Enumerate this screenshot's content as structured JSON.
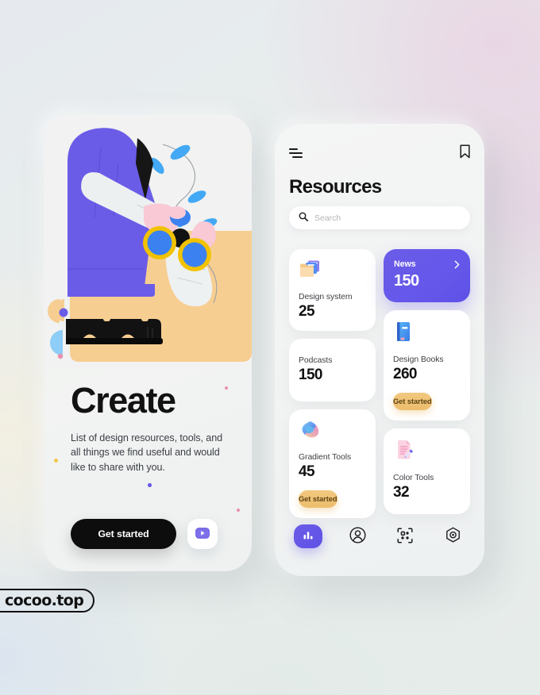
{
  "background": {
    "base_color": "#e8edec",
    "accent_pink": "#e9d5e4",
    "accent_blue": "#d8e2f0"
  },
  "watermark": {
    "label": "cocoo.top"
  },
  "left_phone": {
    "illustration": {
      "name": "person-with-binoculars-illustration",
      "colors": {
        "hoodie": "#6b5ce7",
        "sand": "#f7ce91",
        "leaf": "#43a9f5",
        "skin": "#f9c9d6",
        "sleeve": "#eef1f2",
        "boots": "#121212",
        "binocular_rim": "#f2c200",
        "lens": "#3b82f0"
      }
    },
    "hero": {
      "title": "Create",
      "description": "List of design resources, tools, and all things we find useful and would like to share with you."
    },
    "cta": {
      "primary_label": "Get started",
      "play_icon": "play-icon"
    },
    "decor_dots": [
      {
        "name": "dot-pink-top",
        "color": "#e98fae"
      },
      {
        "name": "dot-yellow-left",
        "color": "#f2c84b"
      },
      {
        "name": "dot-purple-mid",
        "color": "#6b5ce7"
      },
      {
        "name": "dot-pink-bottom",
        "color": "#e98fae"
      }
    ]
  },
  "right_phone": {
    "header": {
      "menu_icon": "hamburger-menu-icon",
      "bookmark_icon": "bookmark-icon"
    },
    "page_title": "Resources",
    "search": {
      "icon": "search-icon",
      "value": "",
      "placeholder": "Search"
    },
    "cards": {
      "left_column": [
        {
          "label": "Design system",
          "value": "25",
          "icon": "folder-icon",
          "style": "white",
          "cta": null
        },
        {
          "label": "Podcasts",
          "value": "150",
          "icon": null,
          "style": "white",
          "cta": null
        },
        {
          "label": "Gradient Tools",
          "value": "45",
          "icon": "gradient-blob-icon",
          "style": "white",
          "cta": "Get started"
        }
      ],
      "right_column": [
        {
          "label": "News",
          "value": "150",
          "icon": "chevron-right-icon",
          "style": "purple",
          "accent": "#6558ea",
          "cta": null
        },
        {
          "label": "Design Books",
          "value": "260",
          "icon": "book-icon",
          "style": "white",
          "cta": "Get started"
        },
        {
          "label": "Color Tools",
          "value": "32",
          "icon": "document-pen-icon",
          "style": "white",
          "cta": null
        }
      ]
    },
    "bottom_nav": [
      {
        "name": "nav-stats",
        "icon": "bar-chart-icon",
        "active": true
      },
      {
        "name": "nav-profile",
        "icon": "user-circle-icon",
        "active": false
      },
      {
        "name": "nav-scan",
        "icon": "qr-scan-icon",
        "active": false
      },
      {
        "name": "nav-settings",
        "icon": "hexagon-target-icon",
        "active": false
      }
    ]
  },
  "palette": {
    "purple": "#6558ea",
    "amber": "#ecbd6c",
    "dark": "#0d0d0d",
    "card_white": "#ffffff"
  }
}
